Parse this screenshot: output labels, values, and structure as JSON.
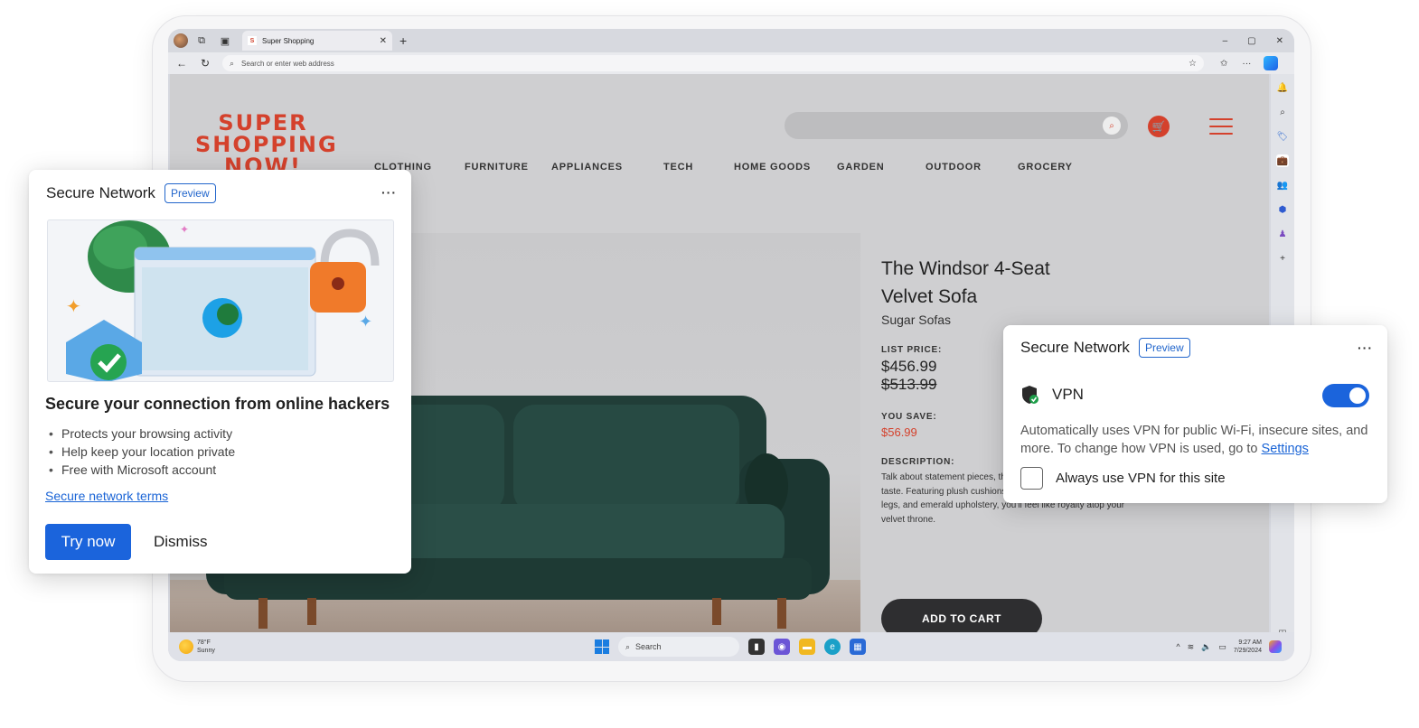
{
  "browser": {
    "tab_title": "Super Shopping",
    "tab_favicon": "S",
    "address_placeholder": "Search or enter web address"
  },
  "site": {
    "logo_lines": [
      "SUPER",
      "SHOPPING",
      "NOW!"
    ],
    "categories": [
      "CLOTHING",
      "FURNITURE",
      "APPLIANCES",
      "TECH",
      "HOME GOODS",
      "GARDEN",
      "OUTDOOR",
      "GROCERY"
    ]
  },
  "product": {
    "title_line1": "The Windsor 4-Seat",
    "title_line2": "Velvet Sofa",
    "brand": "Sugar Sofas",
    "list_price_label": "LIST PRICE:",
    "price": "$456.99",
    "old_price": "$513.99",
    "you_save_label": "YOU SAVE:",
    "savings": "$56.99",
    "description_label": "DESCRIPTION:",
    "description": "Talk about statement pieces, this sofa screams luxury and taste. Featuring plush cushions, tufted seat bench, walnut legs, and emerald upholstery, you'll feel like royalty atop your velvet throne.",
    "add_to_cart": "ADD TO CART"
  },
  "taskbar": {
    "weather_temp": "78°F",
    "weather_cond": "Sunny",
    "search_label": "Search",
    "time": "9:27 AM",
    "date": "7/29/2024"
  },
  "promo_card": {
    "title": "Secure Network",
    "badge": "Preview",
    "more": "···",
    "heading": "Secure your connection from online hackers",
    "bullets": [
      "Protects your browsing activity",
      "Help keep your location private",
      "Free with Microsoft account"
    ],
    "terms_link": "Secure network terms",
    "primary_button": "Try now",
    "secondary_button": "Dismiss"
  },
  "vpn_card": {
    "title": "Secure Network",
    "badge": "Preview",
    "more": "···",
    "vpn_label": "VPN",
    "vpn_enabled": true,
    "description": "Automatically uses VPN for public Wi-Fi, insecure sites, and more. To change how VPN is used, go to ",
    "settings_link": "Settings",
    "checkbox_label": "Always use VPN for this site",
    "checkbox_checked": false
  },
  "colors": {
    "accent_blue": "#1b64dc",
    "brand_red": "#d4412c",
    "sofa_green": "#1f3b36"
  }
}
